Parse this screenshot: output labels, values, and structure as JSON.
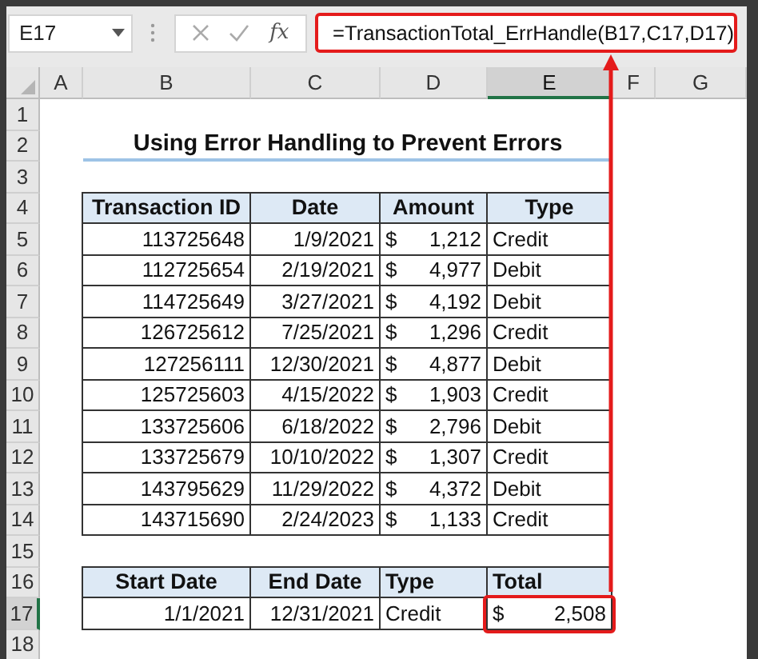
{
  "formula_bar": {
    "name_box": "E17",
    "function_label": "fx",
    "formula": "=TransactionTotal_ErrHandle(B17,C17,D17)"
  },
  "column_headers": [
    {
      "label": "A",
      "selected": false
    },
    {
      "label": "B",
      "selected": false
    },
    {
      "label": "C",
      "selected": false
    },
    {
      "label": "D",
      "selected": false
    },
    {
      "label": "E",
      "selected": true
    },
    {
      "label": "F",
      "selected": false
    },
    {
      "label": "G",
      "selected": false
    }
  ],
  "row_headers": [
    {
      "label": "1",
      "selected": false
    },
    {
      "label": "2",
      "selected": false
    },
    {
      "label": "3",
      "selected": false
    },
    {
      "label": "4",
      "selected": false
    },
    {
      "label": "5",
      "selected": false
    },
    {
      "label": "6",
      "selected": false
    },
    {
      "label": "7",
      "selected": false
    },
    {
      "label": "8",
      "selected": false
    },
    {
      "label": "9",
      "selected": false
    },
    {
      "label": "10",
      "selected": false
    },
    {
      "label": "11",
      "selected": false
    },
    {
      "label": "12",
      "selected": false
    },
    {
      "label": "13",
      "selected": false
    },
    {
      "label": "14",
      "selected": false
    },
    {
      "label": "15",
      "selected": false
    },
    {
      "label": "16",
      "selected": false
    },
    {
      "label": "17",
      "selected": true
    },
    {
      "label": "18",
      "selected": false
    }
  ],
  "title": "Using Error Handling to Prevent Errors",
  "transactions": {
    "columns": [
      "Transaction ID",
      "Date",
      "Amount",
      "Type"
    ],
    "rows": [
      {
        "id": "113725648",
        "date": "1/9/2021",
        "currency": "$",
        "amount": "1,212",
        "type": "Credit"
      },
      {
        "id": "112725654",
        "date": "2/19/2021",
        "currency": "$",
        "amount": "4,977",
        "type": "Debit"
      },
      {
        "id": "114725649",
        "date": "3/27/2021",
        "currency": "$",
        "amount": "4,192",
        "type": "Debit"
      },
      {
        "id": "126725612",
        "date": "7/25/2021",
        "currency": "$",
        "amount": "1,296",
        "type": "Credit"
      },
      {
        "id": "127256111",
        "date": "12/30/2021",
        "currency": "$",
        "amount": "4,877",
        "type": "Debit"
      },
      {
        "id": "125725603",
        "date": "4/15/2022",
        "currency": "$",
        "amount": "1,903",
        "type": "Credit"
      },
      {
        "id": "133725606",
        "date": "6/18/2022",
        "currency": "$",
        "amount": "2,796",
        "type": "Debit"
      },
      {
        "id": "133725679",
        "date": "10/10/2022",
        "currency": "$",
        "amount": "1,307",
        "type": "Credit"
      },
      {
        "id": "143795629",
        "date": "11/29/2022",
        "currency": "$",
        "amount": "4,372",
        "type": "Debit"
      },
      {
        "id": "143715690",
        "date": "2/24/2023",
        "currency": "$",
        "amount": "1,133",
        "type": "Credit"
      }
    ]
  },
  "summary": {
    "columns": [
      "Start Date",
      "End Date",
      "Type",
      "Total"
    ],
    "row": {
      "start_date": "1/1/2021",
      "end_date": "12/31/2021",
      "type": "Credit",
      "currency": "$",
      "total": "2,508"
    }
  },
  "annotation": {
    "formula_boxed": true,
    "cell_boxed": true,
    "arrow": true
  }
}
